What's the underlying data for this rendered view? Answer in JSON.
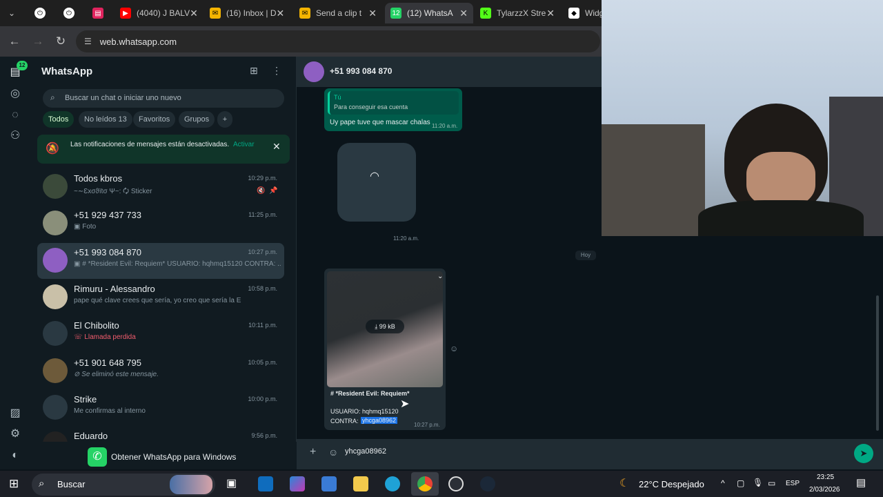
{
  "browser": {
    "tabs": [
      {
        "label": ""
      },
      {
        "label": ""
      },
      {
        "label": ""
      },
      {
        "label": "(4040) J BALV"
      },
      {
        "label": "(16) Inbox | D"
      },
      {
        "label": "Send a clip t"
      },
      {
        "label": "(12) WhatsA"
      },
      {
        "label": "TylarzzX Stre"
      },
      {
        "label": "Widg"
      }
    ],
    "url": "web.whatsapp.com"
  },
  "sidebar_rail": {
    "unread_badge": "12"
  },
  "left": {
    "app_title": "WhatsApp",
    "search_placeholder": "Buscar un chat o iniciar uno nuevo",
    "filters": [
      "Todos",
      "No leídos 13",
      "Favoritos",
      "Grupos"
    ],
    "notice": {
      "text": "Las notificaciones de mensajes están desactivadas.",
      "action": "Activar"
    },
    "chats": [
      {
        "name": "Todos kbros",
        "time": "10:29 p.m.",
        "preview": "~∼Ɛxσϑïtσ Ψ~: 🗘 Sticker"
      },
      {
        "name": "+51 929 437 733",
        "time": "11:25 p.m.",
        "preview": "▣ Foto"
      },
      {
        "name": "+51 993 084 870",
        "time": "10:27 p.m.",
        "preview": "▣ # *Resident Evil: Requiem* USUARIO: hqhmq15120 CONTRA: ..."
      },
      {
        "name": "Rimuru - Alessandro",
        "time": "10:58 p.m.",
        "preview": "pape qué clave crees que sería, yo creo que sería la E"
      },
      {
        "name": "El Chibolito",
        "time": "10:11 p.m.",
        "preview": "☏ Llamada perdida"
      },
      {
        "name": "+51 901 648 795",
        "time": "10:05 p.m.",
        "preview": "⊘ Se eliminó este mensaje."
      },
      {
        "name": "Strike",
        "time": "10:00 p.m.",
        "preview": "Me confirmas al interno"
      },
      {
        "name": "Eduardo",
        "time": "9:56 p.m.",
        "preview": ""
      }
    ],
    "get_app": "Obtener WhatsApp para Windows"
  },
  "chat": {
    "contact": "+51 993 084 870",
    "quote_author": "Tú",
    "quote_text": "Para conseguir esa cuenta",
    "msg1": "Uy pape tuve que mascar chalas",
    "msg1_time": "11:20 a.m.",
    "msg2_time": "11:20 a.m.",
    "date_sep": "Hoy",
    "media_size": "99 kB",
    "caption_title": "# *Resident Evil: Requiem*",
    "caption_user": "USUARIO: hqhmq15120",
    "caption_pass_label": "CONTRA:",
    "caption_pass_value": "yhcga08962",
    "caption_time": "10:27 p.m.",
    "composer_value": "yhcga08962"
  },
  "taskbar": {
    "search": "Buscar",
    "weather": "22°C  Despejado",
    "lang": "ESP",
    "time": "23:25",
    "date": "2/03/2026"
  },
  "colors": {
    "accent": "#00a884",
    "notice_bg": "#103529",
    "bubble_out": "#005c4b",
    "bubble_in": "#202c33"
  }
}
